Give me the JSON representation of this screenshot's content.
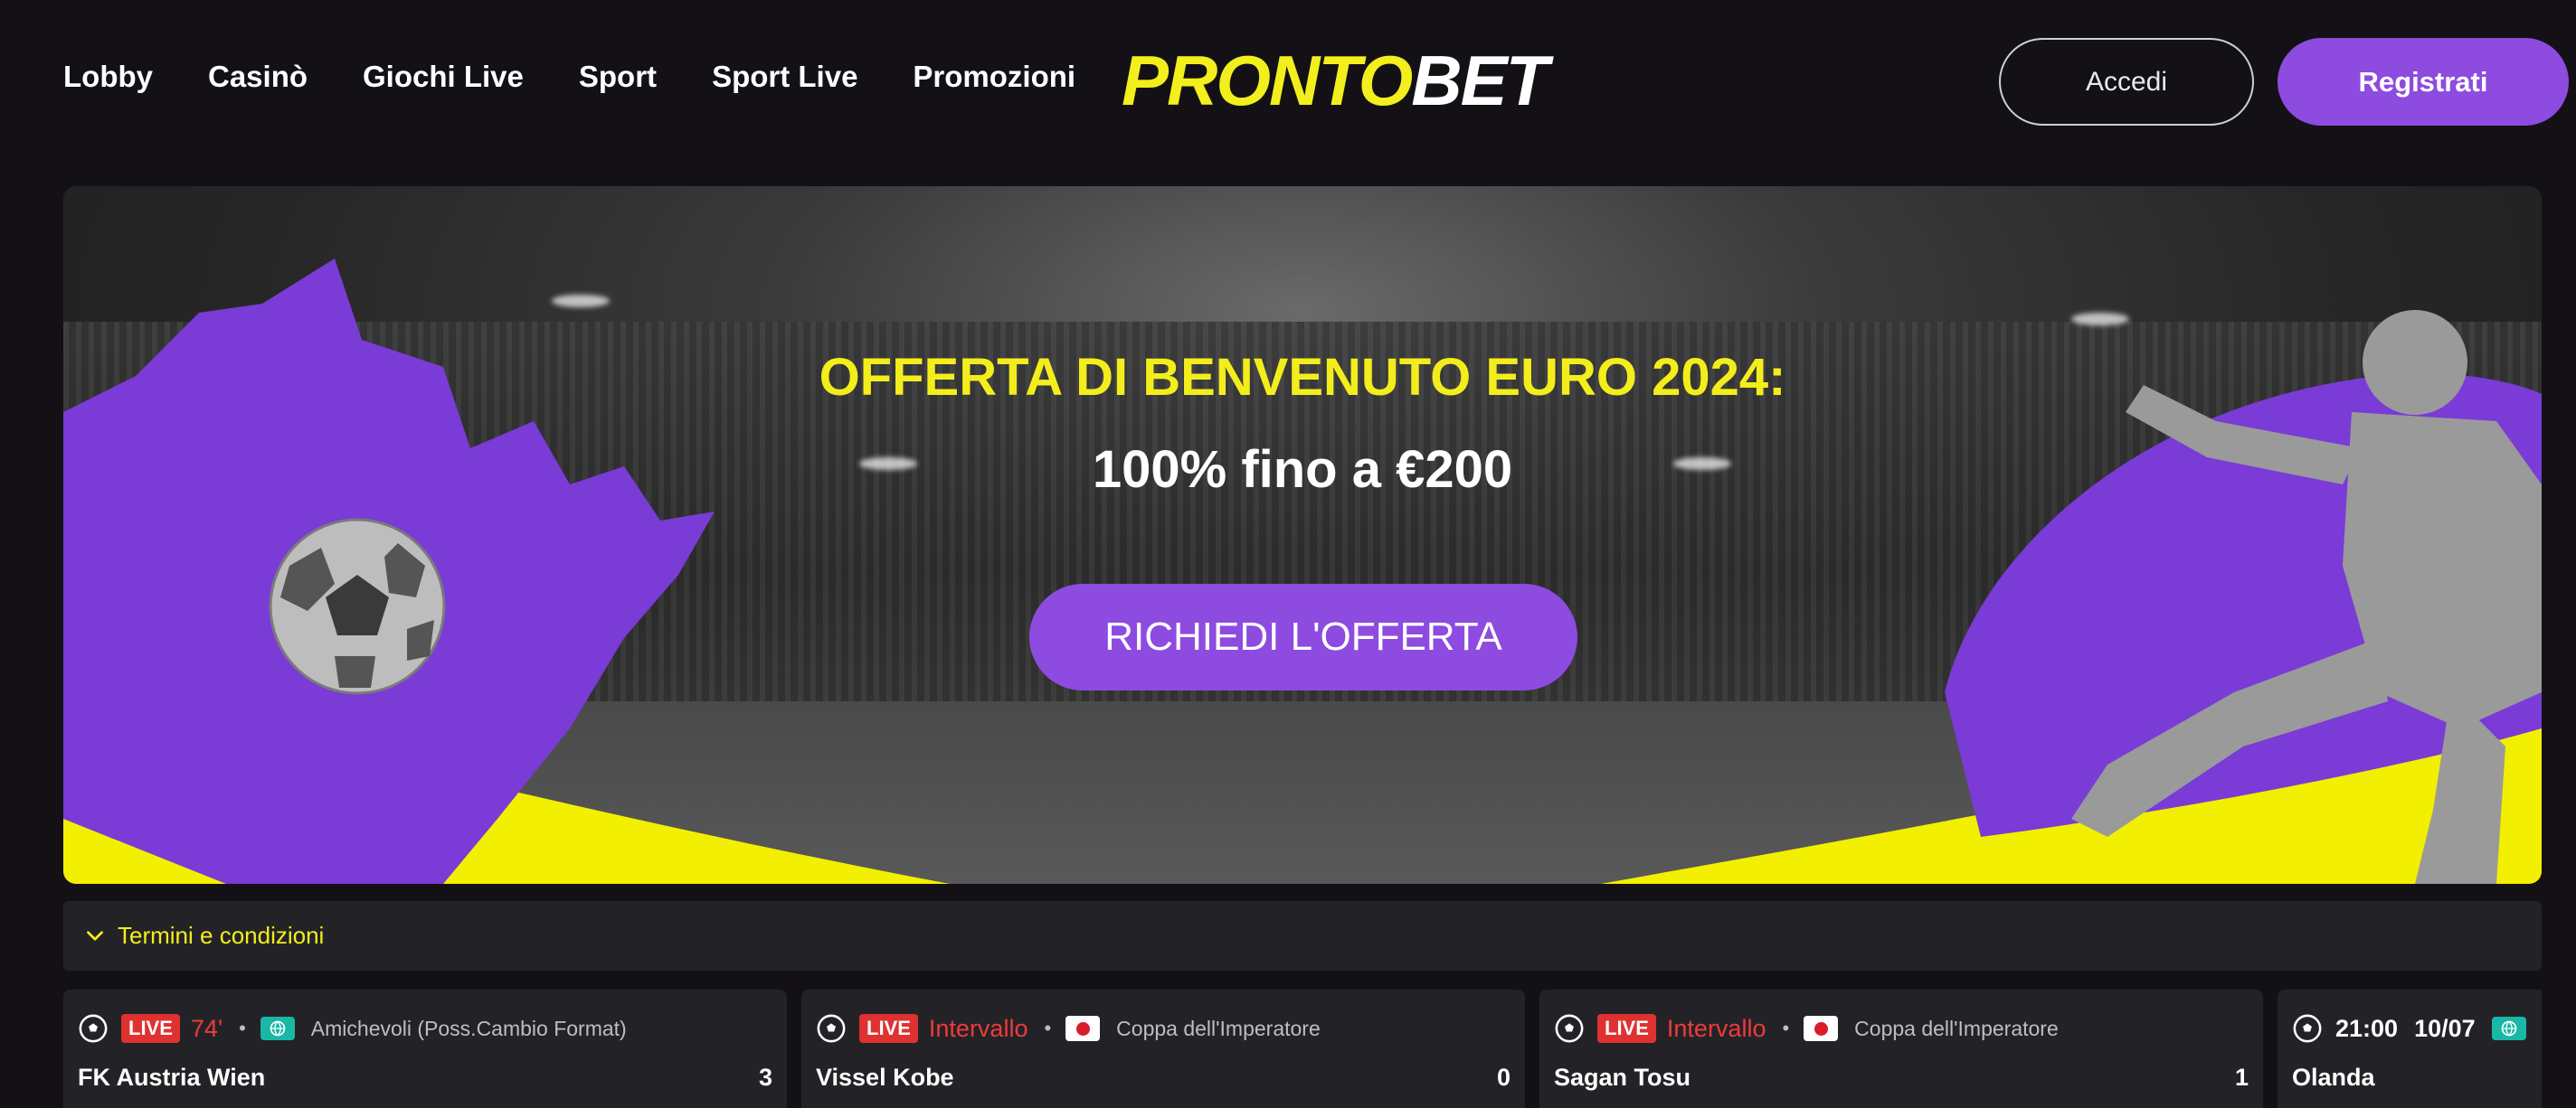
{
  "nav": {
    "items": [
      "Lobby",
      "Casinò",
      "Giochi Live",
      "Sport",
      "Sport Live",
      "Promozioni"
    ]
  },
  "logo": {
    "part1": "PRONTO",
    "part2": "BET"
  },
  "auth": {
    "login_label": "Accedi",
    "register_label": "Registrati"
  },
  "hero": {
    "title": "OFFERTA DI BENVENUTO EURO 2024:",
    "subtitle": "100% fino a €200",
    "cta_label": "RICHIEDI L'OFFERTA"
  },
  "terms": {
    "label": "Termini e condizioni"
  },
  "matches": [
    {
      "live": "LIVE",
      "status": "74'",
      "flag": "world",
      "competition": "Amichevoli (Poss.Cambio Format)",
      "home": "FK Austria Wien",
      "home_score": "3",
      "away": "",
      "away_score": ""
    },
    {
      "live": "LIVE",
      "status": "Intervallo",
      "flag": "japan",
      "competition": "Coppa dell'Imperatore",
      "home": "Vissel Kobe",
      "home_score": "0",
      "away": "",
      "away_score": ""
    },
    {
      "live": "LIVE",
      "status": "Intervallo",
      "flag": "japan",
      "competition": "Coppa dell'Imperatore",
      "home": "Sagan Tosu",
      "home_score": "1",
      "away": "",
      "away_score": ""
    },
    {
      "time": "21:00",
      "date": "10/07",
      "flag": "world",
      "home": "Olanda",
      "away": ""
    }
  ],
  "colors": {
    "background": "#141116",
    "accent_purple": "#8d4be0",
    "accent_yellow": "#f3ee1b",
    "live_red": "#e03131",
    "card_bg": "#232327"
  }
}
